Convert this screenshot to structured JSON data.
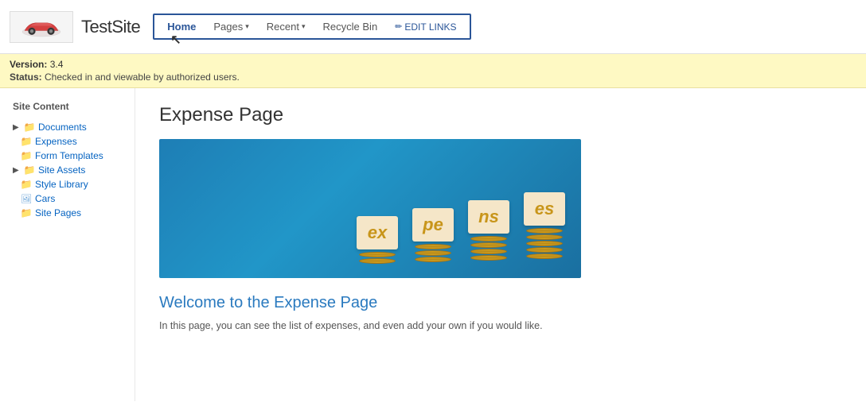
{
  "header": {
    "site_title": "TestSite",
    "logo_alt": "site logo"
  },
  "nav": {
    "items": [
      {
        "id": "home",
        "label": "Home",
        "active": true,
        "has_arrow": false
      },
      {
        "id": "pages",
        "label": "Pages",
        "active": false,
        "has_arrow": true
      },
      {
        "id": "recent",
        "label": "Recent",
        "active": false,
        "has_arrow": true
      },
      {
        "id": "recycle-bin",
        "label": "Recycle Bin",
        "active": false,
        "has_arrow": false
      }
    ],
    "edit_links_label": "EDIT LINKS"
  },
  "status_bar": {
    "version_label": "version:",
    "version_value": "3.4",
    "status_label": "status:",
    "status_value": "Checked in and viewable by authorized users."
  },
  "sidebar": {
    "title": "Site Content",
    "items": [
      {
        "id": "documents",
        "label": "Documents",
        "icon": "folder",
        "expandable": true
      },
      {
        "id": "expenses",
        "label": "Expenses",
        "icon": "folder-orange",
        "expandable": false
      },
      {
        "id": "form-templates",
        "label": "Form Templates",
        "icon": "folder-orange",
        "expandable": false
      },
      {
        "id": "site-assets",
        "label": "Site Assets",
        "icon": "folder",
        "expandable": true
      },
      {
        "id": "style-library",
        "label": "Style Library",
        "icon": "folder-orange",
        "expandable": false
      },
      {
        "id": "cars",
        "label": "Cars",
        "icon": "image",
        "expandable": false
      },
      {
        "id": "site-pages",
        "label": "Site Pages",
        "icon": "folder-orange",
        "expandable": false
      }
    ]
  },
  "main": {
    "page_title": "Expense Page",
    "hero_letters": [
      "ex",
      "pe",
      "ns",
      "es"
    ],
    "welcome_title": "Welcome to the Expense Page",
    "welcome_text": "In this page, you can see the list of expenses, and even add your own if you would like."
  }
}
